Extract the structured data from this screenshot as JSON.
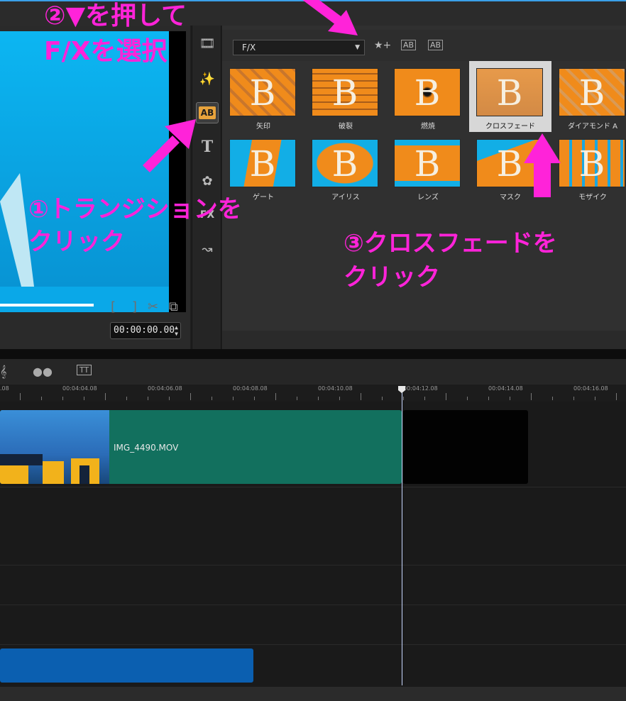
{
  "library": {
    "category": "F/X",
    "transitions": [
      {
        "label": "矢印"
      },
      {
        "label": "破裂"
      },
      {
        "label": "燃焼"
      },
      {
        "label": "クロスフェード"
      },
      {
        "label": "ダイアモンド A"
      },
      {
        "label": "ゲート"
      },
      {
        "label": "アイリス"
      },
      {
        "label": "レンズ"
      },
      {
        "label": "マスク"
      },
      {
        "label": "モザイク"
      }
    ],
    "selected_index": 3
  },
  "toolbar": {
    "transition_glyph": "AB",
    "title_glyph": "T",
    "fx_glyph": "FX"
  },
  "preview": {
    "timecode": "00:00:00.00"
  },
  "timeline": {
    "ruler_labels": [
      ".08",
      "00:04:04.08",
      "00:04:06.08",
      "00:04:08.08",
      "00:04:10.08",
      "00:04:12.08",
      "00:04:14.08",
      "00:04:16.08"
    ],
    "clip_name": "IMG_4490.MOV"
  },
  "annotations": {
    "step1_line1": "①トランジションを",
    "step1_line2": "クリック",
    "step2_line1": "②▼を押して",
    "step2_line2": "F/Xを選択",
    "step3_line1": "③クロスフェードを",
    "step3_line2": "クリック",
    "color": "#ff23d9"
  },
  "icons": {
    "cut": "scissors-icon",
    "mark_in": "mark-in-icon",
    "mark_out": "mark-out-icon"
  }
}
